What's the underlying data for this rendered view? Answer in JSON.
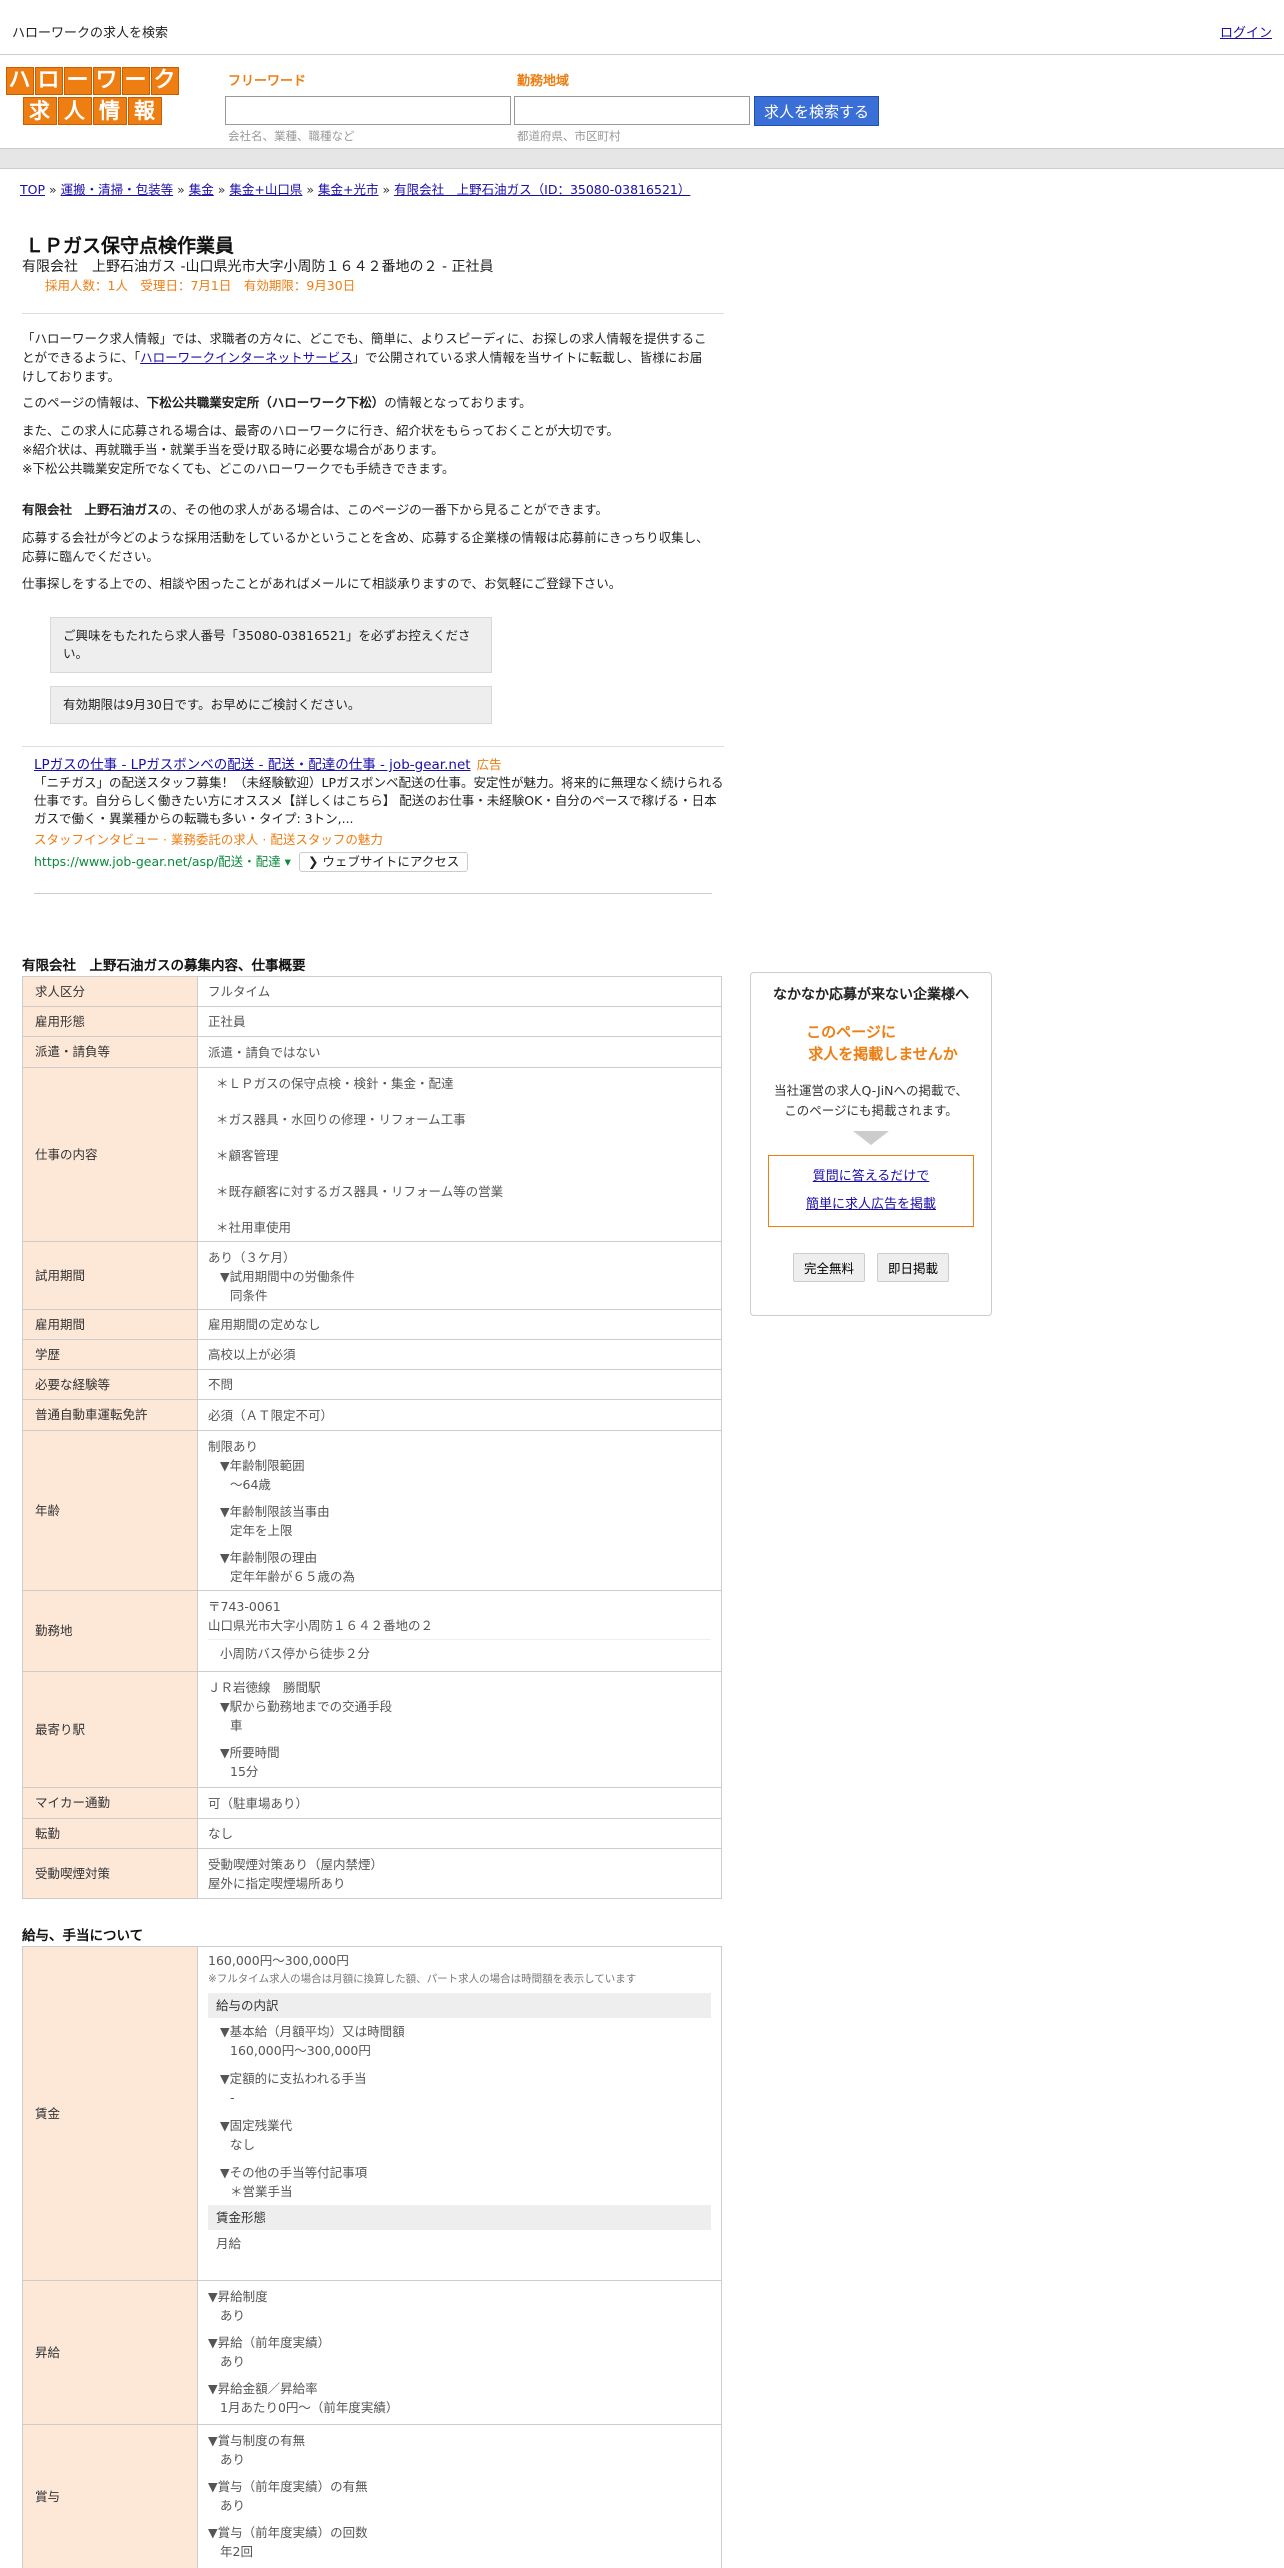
{
  "header": {
    "title": "ハローワークの求人を検索",
    "login": "ログイン"
  },
  "logo": {
    "row1": [
      "ハ",
      "ロ",
      "ー",
      "ワ",
      "ー",
      "ク"
    ],
    "row2": [
      "求",
      "人",
      "情",
      "報"
    ]
  },
  "search": {
    "keyword_label": "フリーワード",
    "keyword_placeholder": "会社名、業種、職種など",
    "area_label": "勤務地域",
    "area_placeholder": "都道府県、市区町村",
    "button": "求人を検索する"
  },
  "breadcrumb": [
    {
      "label": "TOP"
    },
    {
      "label": "運搬・清掃・包装等"
    },
    {
      "label": "集金"
    },
    {
      "label": "集金+山口県"
    },
    {
      "label": "集金+光市"
    },
    {
      "label": "有限会社　上野石油ガス（ID：35080-03816521）"
    }
  ],
  "job": {
    "title": "ＬＰガス保守点検作業員",
    "subtitle": "有限会社　上野石油ガス -山口県光市大字小周防１６４２番地の２ - 正社員",
    "info": "採用人数：1人　受理日：7月1日　有効期限：9月30日"
  },
  "intro": {
    "p1a": "「ハローワーク求人情報」では、求職者の方々に、どこでも、簡単に、よりスピーディに、お探しの求人情報を提供することができるように、「",
    "p1link": "ハローワークインターネットサービス",
    "p1b": "」で公開されている求人情報を当サイトに転載し、皆様にお届けしております。",
    "p2a": "このページの情報は、",
    "p2b": "下松公共職業安定所（ハローワーク下松）",
    "p2c": "の情報となっております。",
    "p3": [
      "また、この求人に応募される場合は、最寄のハローワークに行き、紹介状をもらっておくことが大切です。",
      "※紹介状は、再就職手当・就業手当を受け取る時に必要な場合があります。",
      "※下松公共職業安定所でなくても、どこのハローワークでも手続きできます。"
    ],
    "p4a": "有限会社　上野石油ガス",
    "p4b": "の、その他の求人がある場合は、このページの一番下から見ることができます。",
    "p5": "応募する会社が今どのような採用活動をしているかということを含め、応募する企業様の情報は応募前にきっちり収集し、応募に臨んでください。",
    "p6": "仕事探しをする上での、相談や困ったことがあればメールにて相談承りますので、お気軽にご登録下さい。"
  },
  "notes": [
    "ご興味をもたれたら求人番号「35080-03816521」を必ずお控えください。",
    "有効期限は9月30日です。お早めにご検討ください。"
  ],
  "ad": {
    "title": "LPガスの仕事 - LPガスボンベの配送 - 配送・配達の仕事 - job-gear.net",
    "label": "広告",
    "desc": "「ニチガス」の配送スタッフ募集！（未経験歓迎）LPガスボンベ配送の仕事。安定性が魅力。将来的に無理なく続けられる仕事です。自分らしく働きたい方にオススメ【詳しくはこちら】 配送のお仕事・未経験OK・自分のペースで稼げる・日本ガスで働く・異業種からの転職も多い・タイプ: 3トン,...",
    "sublink": "スタッフインタビュー · 業務委託の求人 · 配送スタッフの魅力",
    "url": "https://www.job-gear.net/asp/配送・配達",
    "visit": "❯ ウェブサイトにアクセス"
  },
  "details_heading": "有限会社　上野石油ガスの募集内容、仕事概要",
  "details": {
    "r1": {
      "k": "求人区分",
      "v": "フルタイム"
    },
    "r2": {
      "k": "雇用形態",
      "v": "正社員"
    },
    "r3": {
      "k": "派遣・請負等",
      "v": "派遣・請負ではない"
    },
    "r4": {
      "k": "仕事の内容",
      "v": [
        "＊ＬＰガスの保守点検・検針・集金・配達",
        "＊ガス器具・水回りの修理・リフォーム工事",
        "＊顧客管理",
        "＊既存顧客に対するガス器具・リフォーム等の営業",
        "＊社用車使用"
      ]
    },
    "r5": {
      "k": "試用期間",
      "v1": "あり（３ケ月）",
      "v2": "▼試用期間中の労働条件",
      "v3": "同条件"
    },
    "r6": {
      "k": "雇用期間",
      "v": "雇用期間の定めなし"
    },
    "r7": {
      "k": "学歴",
      "v": "高校以上が必須"
    },
    "r8": {
      "k": "必要な経験等",
      "v": "不問"
    },
    "r9": {
      "k": "普通自動車運転免許",
      "v": "必須（ＡＴ限定不可）"
    },
    "r10": {
      "k": "年齢",
      "v1": "制限あり",
      "v2": "▼年齢制限範囲",
      "v3": "〜64歳",
      "v4": "▼年齢制限該当事由",
      "v5": "定年を上限",
      "v6": "▼年齢制限の理由",
      "v7": "定年年齢が６５歳の為"
    },
    "r11": {
      "k": "勤務地",
      "v1": "〒743-0061",
      "v2": "山口県光市大字小周防１６４２番地の２",
      "v3": "小周防バス停から徒歩２分"
    },
    "r12": {
      "k": "最寄り駅",
      "v1": "ＪＲ岩徳線　勝間駅",
      "v2": "▼駅から勤務地までの交通手段",
      "v3": "車",
      "v4": "▼所要時間",
      "v5": "15分"
    },
    "r13": {
      "k": "マイカー通勤",
      "v": "可（駐車場あり）"
    },
    "r14": {
      "k": "転勤",
      "v": "なし"
    },
    "r15": {
      "k": "受動喫煙対策",
      "v1": "受動喫煙対策あり（屋内禁煙）",
      "v2": "屋外に指定喫煙場所あり"
    }
  },
  "salary_heading": "給与、手当について",
  "salary": {
    "wage": {
      "k": "賃金",
      "range": "160,000円〜300,000円",
      "note": "※フルタイム求人の場合は月額に換算した額、パート求人の場合は時間額を表示しています",
      "breakdown_h": "給与の内訳",
      "b1": "▼基本給（月額平均）又は時間額",
      "b1v": "160,000円〜300,000円",
      "b2": "▼定額的に支払われる手当",
      "b2v": "-",
      "b3": "▼固定残業代",
      "b3v": "なし",
      "b4": "▼その他の手当等付記事項",
      "b4v": "＊営業手当",
      "form_h": "賃金形態",
      "form_v": "月給"
    },
    "raise": {
      "k": "昇給",
      "a1": "▼昇給制度",
      "a1v": "あり",
      "a2": "▼昇給（前年度実績）",
      "a2v": "あり",
      "a3": "▼昇給金額／昇給率",
      "a3v": "1月あたり0円〜（前年度実績）"
    },
    "bonus": {
      "k": "賞与",
      "a1": "▼賞与制度の有無",
      "a1v": "あり",
      "a2": "▼賞与（前年度実績）の有無",
      "a2v": "あり",
      "a3": "▼賞与（前年度実績）の回数",
      "a3v": "年2回"
    }
  },
  "sidebar": {
    "t1": "なかなか応募が来ない企業様へ",
    "t2a": "このページに",
    "t2b": "求人を掲載しませんか",
    "t3a": "当社運営の求人Q-JiNへの掲載で、",
    "t3b": "このページにも掲載されます。",
    "link1": "質問に答えるだけで",
    "link2": "簡単に求人広告を掲載",
    "btn1": "完全無料",
    "btn2": "即日掲載"
  },
  "colors": {
    "accent": "#ee7d12",
    "link": "#1a0dab",
    "button": "#3a6fd8",
    "th_bg": "#fde8d8"
  }
}
